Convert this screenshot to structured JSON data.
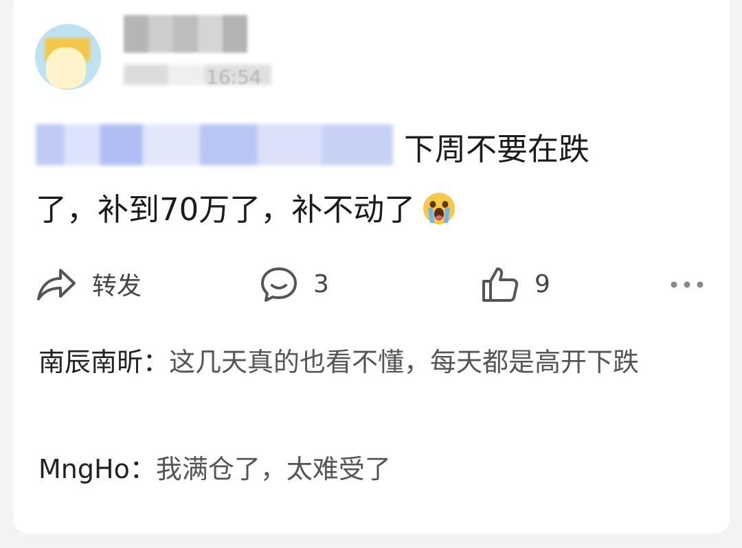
{
  "post": {
    "avatar_icon": "cartoon-avatar",
    "time_partial": "16:54",
    "content_line1": "下周不要在跌",
    "content_line2": "了，补到70万了，补不动了",
    "emoji": "crying-face-emoji"
  },
  "actions": {
    "repost_label": "转发",
    "comment_count": "3",
    "like_count": "9"
  },
  "comments": [
    {
      "user": "南辰南昕",
      "separator": "：",
      "text": "这几天真的也看不懂，每天都是高开下跌"
    },
    {
      "user": "MngHo",
      "separator": "：",
      "text": "我满仓了，太难受了"
    }
  ]
}
